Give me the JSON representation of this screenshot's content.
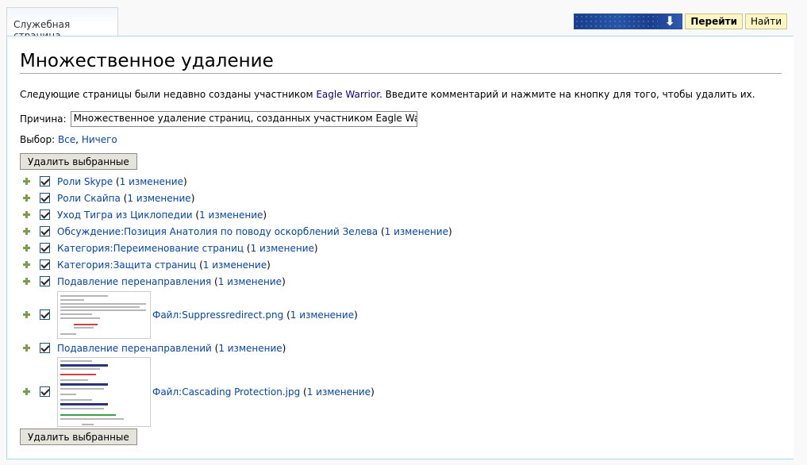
{
  "tab": {
    "label": "Служебная страница"
  },
  "search": {
    "go_label": "Перейти",
    "find_label": "Найти"
  },
  "page": {
    "title": "Множественное удаление",
    "intro_before": "Следующие страницы были недавно созданы участником ",
    "user_link": "Eagle Warrior",
    "intro_after": ". Введите комментарий и нажмите на кнопку для того, чтобы удалить их.",
    "reason_label": "Причина:",
    "reason_value": "Множественное удаление страниц, созданных участником Eagle Warrio",
    "select_label": "Выбор:",
    "select_all": "Все",
    "select_sep": ",",
    "select_none": "Ничего",
    "delete_button": "Удалить выбранные"
  },
  "items": [
    {
      "title": "Роли Skype",
      "changes": "1 изменение"
    },
    {
      "title": "Роли Скайпа",
      "changes": "1 изменение"
    },
    {
      "title": "Уход Тигра из Циклопедии",
      "changes": "1 изменение"
    },
    {
      "title": "Обсуждение:Позиция Анатолия по поводу оскорблений Зелева",
      "changes": "1 изменение"
    },
    {
      "title": "Категория:Переименование страниц",
      "changes": "1 изменение"
    },
    {
      "title": "Категория:Защита страниц",
      "changes": "1 изменение"
    },
    {
      "title": "Подавление перенаправления",
      "changes": "1 изменение"
    },
    {
      "title": "Файл:Suppressredirect.png",
      "changes": "1 изменение"
    },
    {
      "title": "Подавление перенаправлений",
      "changes": "1 изменение"
    },
    {
      "title": "Файл:Cascading Protection.jpg",
      "changes": "1 изменение"
    }
  ]
}
